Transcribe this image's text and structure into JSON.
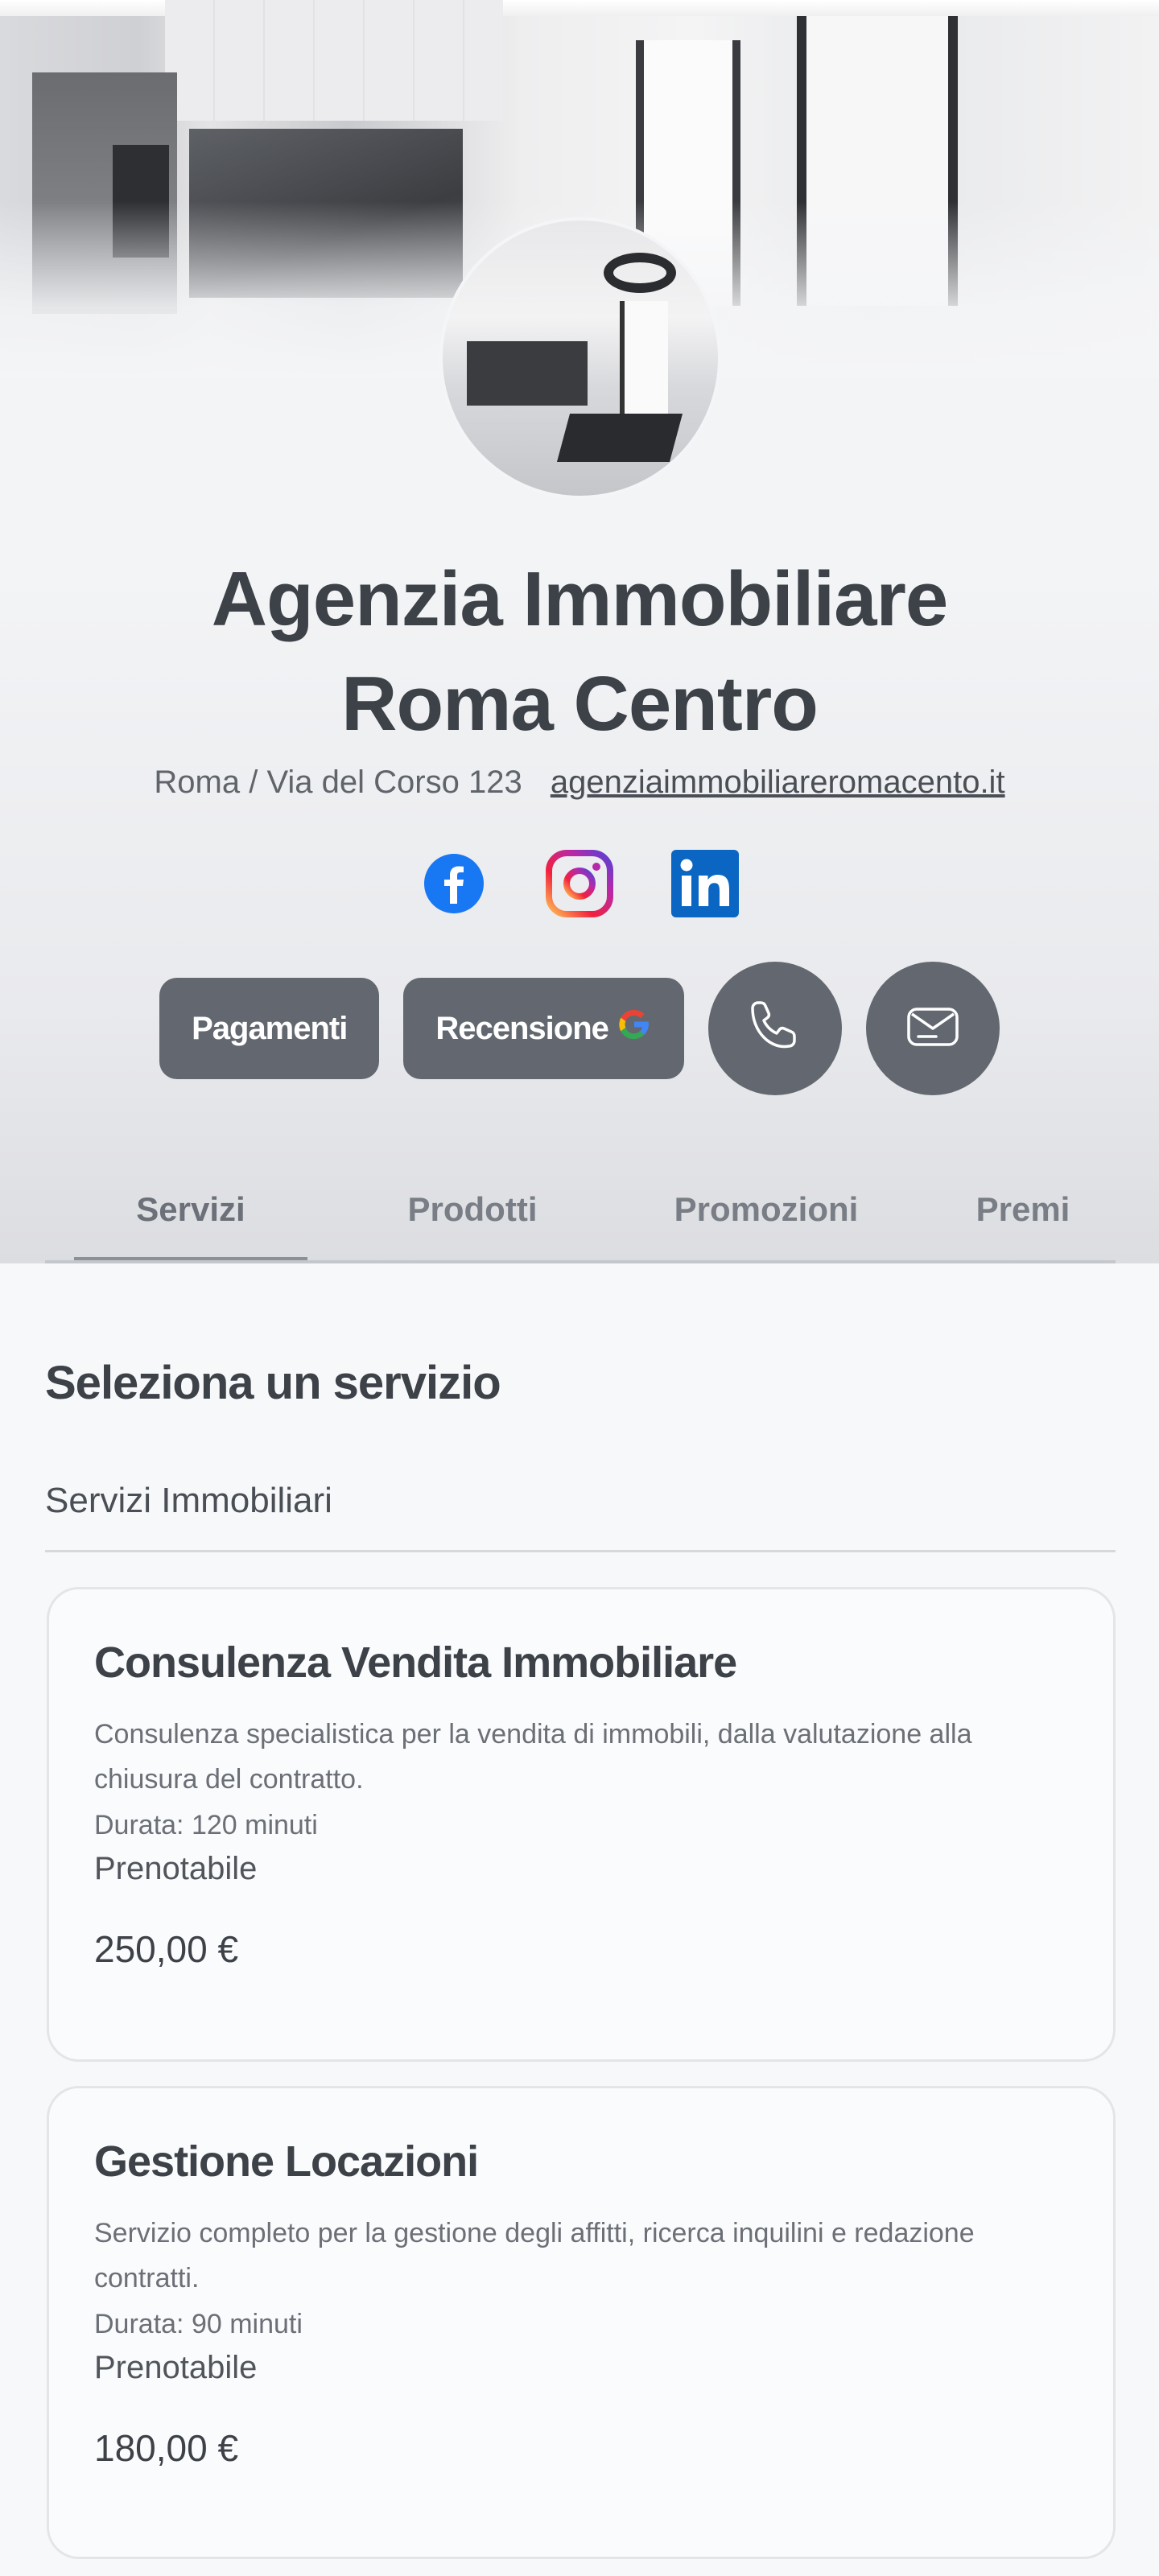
{
  "business": {
    "name": "Agenzia Immobiliare Roma Centro",
    "address": "Roma / Via del Corso 123",
    "website": "agenziaimmobiliareromacento.it"
  },
  "socials": [
    {
      "name": "facebook",
      "icon": "facebook-icon",
      "color": "#1877F2"
    },
    {
      "name": "instagram",
      "icon": "instagram-icon",
      "color": "#E1306C"
    },
    {
      "name": "linkedin",
      "icon": "linkedin-icon",
      "color": "#0A66C2"
    }
  ],
  "actions": {
    "payments_label": "Pagamenti",
    "review_label": "Recensione",
    "phone_icon": "phone-icon",
    "message_icon": "message-icon"
  },
  "tabs": [
    {
      "label": "Servizi",
      "active": true
    },
    {
      "label": "Prodotti",
      "active": false
    },
    {
      "label": "Promozioni",
      "active": false
    },
    {
      "label": "Premi",
      "active": false
    }
  ],
  "services_section": {
    "title": "Seleziona un servizio",
    "category": "Servizi Immobiliari",
    "items": [
      {
        "name": "Consulenza Vendita Immobiliare",
        "description": "Consulenza specialistica per la vendita di immobili, dalla valutazione alla chiusura del contratto.",
        "duration": "Durata: 120 minuti",
        "status": "Prenotabile",
        "price": "250,00 €"
      },
      {
        "name": "Gestione Locazioni",
        "description": "Servizio completo per la gestione degli affitti, ricerca inquilini e redazione contratti.",
        "duration": "Durata: 90 minuti",
        "status": "Prenotabile",
        "price": "180,00 €"
      }
    ]
  },
  "colors": {
    "button_bg": "#636870",
    "text_dark": "#3d4148",
    "background": "#f7f8fa"
  }
}
